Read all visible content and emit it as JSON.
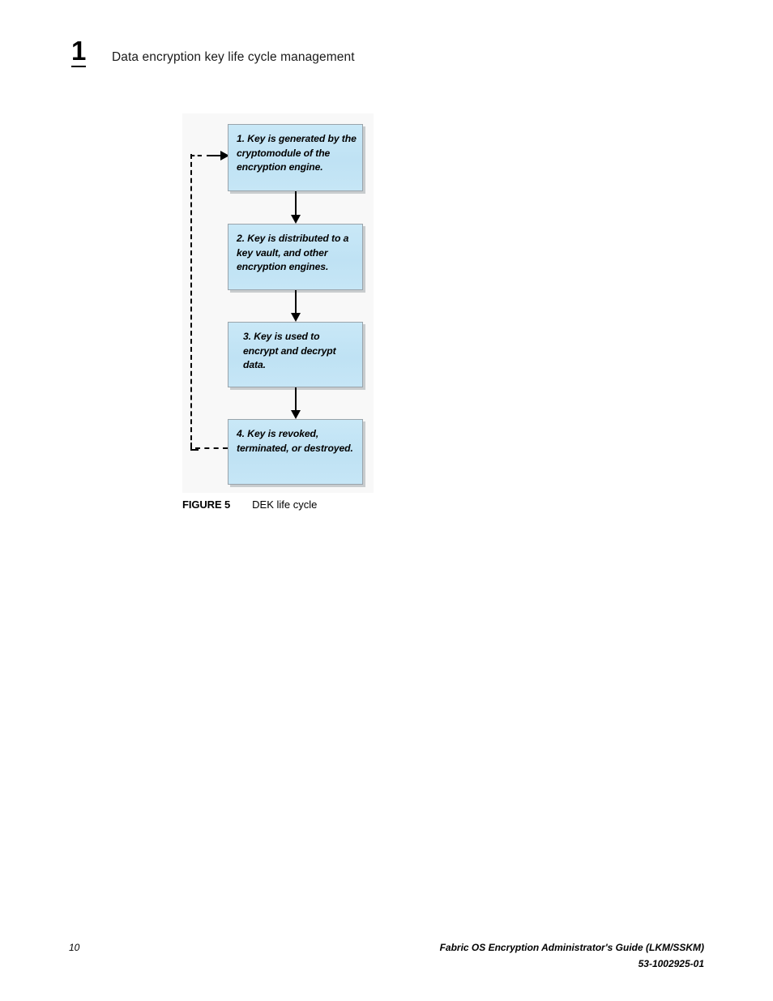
{
  "header": {
    "chapter_number": "1",
    "title": "Data encryption key life cycle management"
  },
  "figure": {
    "caption_label": "FIGURE 5",
    "caption_title": "DEK life cycle",
    "diagram_type": "flowchart",
    "boxes": [
      {
        "id": "step-1",
        "text": "1. Key is generated by the cryptomodule of the encryption engine."
      },
      {
        "id": "step-2",
        "text": "2. Key is distributed to a key vault, and other encryption engines."
      },
      {
        "id": "step-3",
        "text": "3. Key is used to encrypt and decrypt data."
      },
      {
        "id": "step-4",
        "text": "4. Key is revoked, terminated, or destroyed."
      }
    ],
    "connectors": [
      {
        "from": "step-1",
        "to": "step-2",
        "style": "solid-arrow-down"
      },
      {
        "from": "step-2",
        "to": "step-3",
        "style": "solid-arrow-down"
      },
      {
        "from": "step-3",
        "to": "step-4",
        "style": "solid-arrow-down"
      },
      {
        "from": "step-4",
        "to": "step-1",
        "style": "dashed-loop-back"
      }
    ],
    "colors": {
      "box_fill": "#c3e5f6",
      "box_border": "#9aa4ab",
      "box_shadow": "#c8ccce",
      "canvas_background": "#f8f8f8",
      "connector": "#000000"
    }
  },
  "footer": {
    "page_number": "10",
    "guide_title": "Fabric OS Encryption Administrator's Guide  (LKM/SSKM)",
    "document_number": "53-1002925-01"
  }
}
